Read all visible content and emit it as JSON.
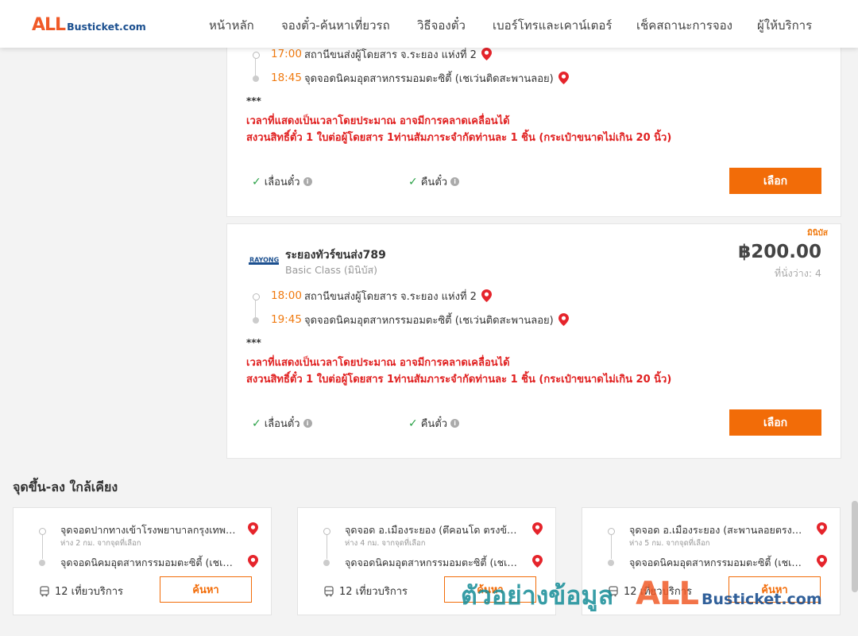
{
  "header": {
    "logo_all": "ALL",
    "logo_rest": "Busticket.com",
    "nav": [
      "หน้าหลัก",
      "จองตั๋ว-ค้นหาเที่ยวรถ",
      "วิธีจองตั๋ว",
      "เบอร์โทรและเคาน์เตอร์",
      "เช็คสถานะการจอง",
      "ผู้ให้บริการ"
    ]
  },
  "trips": [
    {
      "depart_time": "17:00",
      "depart_place": "สถานีขนส่งผู้โดยสาร จ.ระยอง แห่งที่ 2",
      "arrive_time": "18:45",
      "arrive_place": "จุดจอดนิคมอุตสาหกรรมอมตะซิตี้ (เชเว่นติดสะพานลอย)",
      "stars": "***",
      "note1": "เวลาที่แสดงเป็นเวลาโดยประมาณ อาจมีการคลาดเคลื่อนได้",
      "note2": "สงวนสิทธิ์ตั๋ว 1 ใบต่อผู้โดยสาร 1ท่านสัมภาระจำกัดท่านละ 1 ชิ้น (กระเป๋าขนาดไม่เกิน 20 นิ้ว)",
      "feature1": "เลื่อนตั๋ว",
      "feature2": "คืนตั๋ว",
      "select_label": "เลือก"
    },
    {
      "tag": "มินิบัส",
      "operator_name": "ระยองทัวร์ขนส่ง789",
      "operator_logo_text": "RAYONG",
      "bus_class": "Basic Class (มินิบัส)",
      "price": "฿200.00",
      "seats": "ที่นั่งว่าง: 4",
      "depart_time": "18:00",
      "depart_place": "สถานีขนส่งผู้โดยสาร จ.ระยอง แห่งที่ 2",
      "arrive_time": "19:45",
      "arrive_place": "จุดจอดนิคมอุตสาหกรรมอมตะซิตี้ (เชเว่นติดสะพานลอย)",
      "stars": "***",
      "note1": "เวลาที่แสดงเป็นเวลาโดยประมาณ อาจมีการคลาดเคลื่อนได้",
      "note2": "สงวนสิทธิ์ตั๋ว 1 ใบต่อผู้โดยสาร 1ท่านสัมภาระจำกัดท่านละ 1 ชิ้น (กระเป๋าขนาดไม่เกิน 20 นิ้ว)",
      "feature1": "เลื่อนตั๋ว",
      "feature2": "คืนตั๋ว",
      "select_label": "เลือก"
    }
  ],
  "nearby": {
    "title": "จุดขึ้น-ลง ใกล้เคียง",
    "cards": [
      {
        "from": "จุดจอดปากทางเข้าโรงพยาบาลกรุงเทพระยอง",
        "distance": "ห่าง 2 กม. จากจุดที่เลือก",
        "to": "จุดจอดนิคมอุตสาหกรรมอมตะซิตี้ (เชเว่นติดสะพานลอย)",
        "trips": "12 เที่ยวบริการ",
        "button": "ค้นหา"
      },
      {
        "from": "จุดจอด อ.เมืองระยอง (ตึคอนโด ตรงข้ามตลาด)",
        "distance": "ห่าง 4 กม. จากจุดที่เลือก",
        "to": "จุดจอดนิคมอุตสาหกรรมอมตะซิตี้ (เชเว่นติดสะพานลอย)",
        "trips": "12 เที่ยวบริการ",
        "button": "ค้นหา"
      },
      {
        "from": "จุดจอด อ.เมืองระยอง (สะพานลอยตรงข้ามห้าง)",
        "distance": "ห่าง 5 กม. จากจุดที่เลือก",
        "to": "จุดจอดนิคมอุตสาหกรรมอมตะซิตี้ (เชเว่นติดสะพานลอย)",
        "trips": "12 เที่ยวบริการ",
        "button": "ค้นหา"
      }
    ]
  },
  "watermark": {
    "text": "ตัวอย่างข้อมูล",
    "all": "ALL",
    "rest": "Busticket.com"
  },
  "colors": {
    "accent": "#f26c08",
    "time": "#f07a10",
    "warning": "#e02020",
    "check": "#2aa147",
    "pin": "#e5242b"
  }
}
